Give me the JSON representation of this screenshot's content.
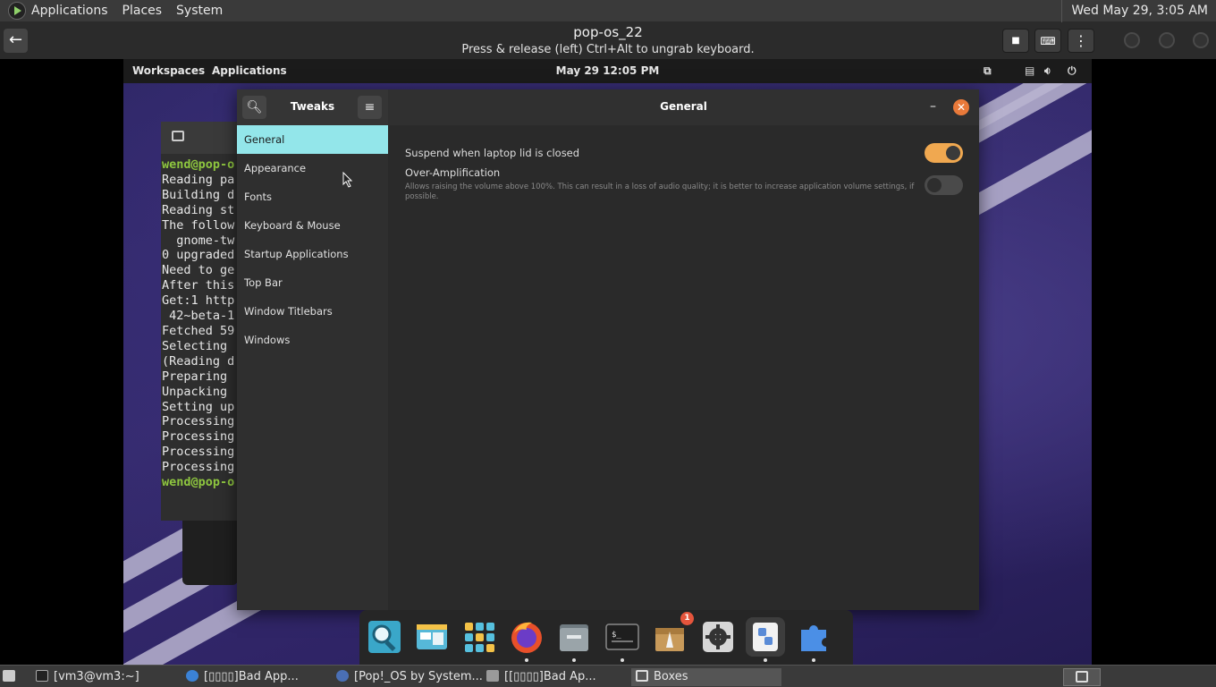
{
  "host_panel": {
    "menus": [
      "Applications",
      "Places",
      "System"
    ],
    "clock": "Wed May 29,  3:05 AM"
  },
  "boxes_header": {
    "title": "pop-os_22",
    "subtitle": "Press & release (left) Ctrl+Alt to ungrab keyboard."
  },
  "guest_top_bar": {
    "workspaces": "Workspaces",
    "applications": "Applications",
    "clock": "May 29  12:05 PM"
  },
  "terminal": {
    "lines": [
      {
        "text": "wend@pop-o",
        "style": "green"
      },
      {
        "text": "Reading pa",
        "style": ""
      },
      {
        "text": "Building d",
        "style": ""
      },
      {
        "text": "Reading st",
        "style": ""
      },
      {
        "text": "The follow",
        "style": ""
      },
      {
        "text": "  gnome-tw",
        "style": ""
      },
      {
        "text": "0 upgraded",
        "style": ""
      },
      {
        "text": "Need to ge",
        "style": ""
      },
      {
        "text": "After this",
        "style": ""
      },
      {
        "text": "Get:1 http",
        "style": ""
      },
      {
        "text": " 42~beta-1",
        "style": ""
      },
      {
        "text": "Fetched 59",
        "style": ""
      },
      {
        "text": "Selecting ",
        "style": ""
      },
      {
        "text": "(Reading d",
        "style": ""
      },
      {
        "text": "Preparing ",
        "style": ""
      },
      {
        "text": "Unpacking ",
        "style": ""
      },
      {
        "text": "Setting up",
        "style": ""
      },
      {
        "text": "Processing",
        "style": ""
      },
      {
        "text": "Processing",
        "style": ""
      },
      {
        "text": "Processing",
        "style": ""
      },
      {
        "text": "Processing",
        "style": ""
      },
      {
        "text": "wend@pop-o",
        "style": "green"
      }
    ]
  },
  "tweaks": {
    "sidebar_title": "Tweaks",
    "main_title": "General",
    "sidebar_items": [
      "General",
      "Appearance",
      "Fonts",
      "Keyboard & Mouse",
      "Startup Applications",
      "Top Bar",
      "Window Titlebars",
      "Windows"
    ],
    "active_item": "General",
    "settings": {
      "suspend": {
        "label": "Suspend when laptop lid is closed",
        "enabled": true
      },
      "over_amp": {
        "label": "Over-Amplification",
        "description": "Allows raising the volume above 100%. This can result in a loss of audio quality; it is better to increase application volume settings, if possible.",
        "enabled": false
      }
    }
  },
  "dock": {
    "items": [
      {
        "name": "search",
        "running": false
      },
      {
        "name": "files-manager",
        "running": false
      },
      {
        "name": "app-grid",
        "running": false
      },
      {
        "name": "firefox",
        "running": true
      },
      {
        "name": "files",
        "running": true
      },
      {
        "name": "terminal",
        "running": true
      },
      {
        "name": "pop-shop",
        "running": false,
        "badge": "1"
      },
      {
        "name": "settings",
        "running": false
      },
      {
        "name": "tweaks",
        "running": true
      },
      {
        "name": "extensions",
        "running": true
      }
    ]
  },
  "taskbar": {
    "items": [
      {
        "label": "[vm3@vm3:~]"
      },
      {
        "label": "[▯▯▯▯]Bad App..."
      },
      {
        "label": "[Pop!_OS by System..."
      },
      {
        "label": "[[▯▯▯▯]Bad Ap..."
      },
      {
        "label": "Boxes"
      }
    ]
  },
  "colors": {
    "accent_active": "#93e6ea",
    "toggle_on": "#f0a850",
    "close": "#e8793a"
  }
}
